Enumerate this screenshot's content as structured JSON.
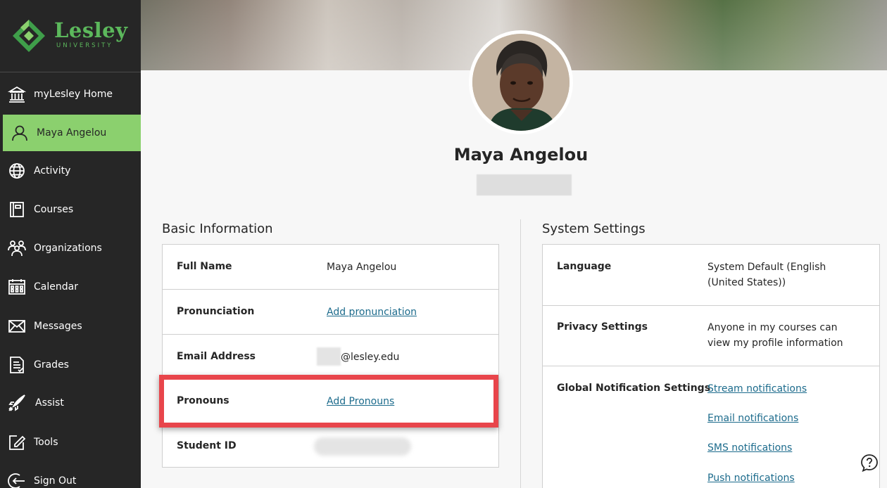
{
  "brand": {
    "name": "Lesley",
    "subtitle": "UNIVERSITY",
    "color": "#5cb85c"
  },
  "nav": [
    {
      "label": "myLesley Home",
      "icon": "institution-icon"
    },
    {
      "label": "Maya Angelou",
      "icon": "user-icon",
      "active": true
    },
    {
      "label": "Activity",
      "icon": "globe-icon"
    },
    {
      "label": "Courses",
      "icon": "book-icon"
    },
    {
      "label": "Organizations",
      "icon": "group-icon"
    },
    {
      "label": "Calendar",
      "icon": "calendar-icon"
    },
    {
      "label": "Messages",
      "icon": "envelope-icon"
    },
    {
      "label": "Grades",
      "icon": "grades-icon"
    },
    {
      "label": "Assist",
      "icon": "rocket-icon"
    },
    {
      "label": "Tools",
      "icon": "edit-icon"
    },
    {
      "label": "Sign Out",
      "icon": "sign-out-icon"
    }
  ],
  "profile": {
    "name": "Maya Angelou"
  },
  "basic": {
    "title": "Basic Information",
    "full_name_label": "Full Name",
    "full_name_value": "Maya Angelou",
    "pronunciation_label": "Pronunciation",
    "pronunciation_link": "Add pronunciation",
    "email_label": "Email Address",
    "email_value": "@lesley.edu",
    "pronouns_label": "Pronouns",
    "pronouns_link": "Add Pronouns",
    "student_id_label": "Student ID"
  },
  "system": {
    "title": "System Settings",
    "language_label": "Language",
    "language_value_1": "System Default (English",
    "language_value_2": "(United States))",
    "privacy_label": "Privacy Settings",
    "privacy_value_1": "Anyone in my courses can",
    "privacy_value_2": "view my profile information",
    "notifications_label": "Global Notification Settings",
    "stream_link": "Stream notifications",
    "email_link": "Email notifications",
    "sms_link": "SMS notifications",
    "push_link": "Push notifications"
  },
  "colors": {
    "active_nav": "#8bd06e",
    "link": "#1c6b8c",
    "highlight": "#e8454b",
    "sidebar": "#262626"
  },
  "help": {
    "icon": "help-icon"
  }
}
